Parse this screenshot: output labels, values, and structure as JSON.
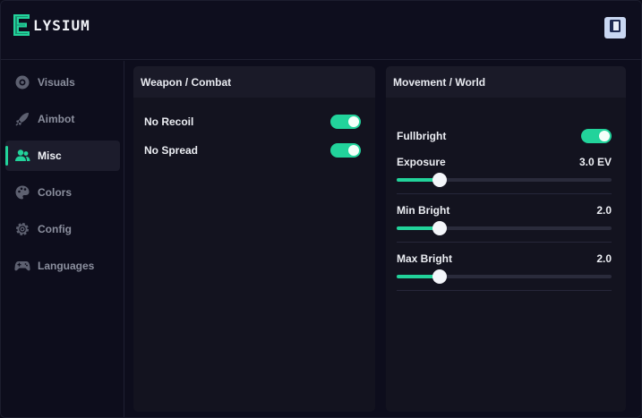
{
  "app": {
    "brand": "LYSIUM"
  },
  "header": {
    "button_icon": "book-icon"
  },
  "sidebar": {
    "items": [
      {
        "label": "Visuals",
        "icon": "eye-icon",
        "active": false
      },
      {
        "label": "Aimbot",
        "icon": "rocket-icon",
        "active": false
      },
      {
        "label": "Misc",
        "icon": "users-icon",
        "active": true
      },
      {
        "label": "Colors",
        "icon": "palette-icon",
        "active": false
      },
      {
        "label": "Config",
        "icon": "gear-icon",
        "active": false
      },
      {
        "label": "Languages",
        "icon": "gamepad-icon",
        "active": false
      }
    ]
  },
  "panels": {
    "weapon": {
      "title": "Weapon / Combat",
      "toggles": [
        {
          "label": "No Recoil",
          "on": true
        },
        {
          "label": "No Spread",
          "on": true
        }
      ]
    },
    "movement": {
      "title": "Movement / World",
      "fullbright": {
        "label": "Fullbright",
        "on": true
      },
      "sliders": [
        {
          "label": "Exposure",
          "value": "3.0 EV",
          "fraction": 0.2
        },
        {
          "label": "Min Bright",
          "value": "2.0",
          "fraction": 0.2
        },
        {
          "label": "Max Bright",
          "value": "2.0",
          "fraction": 0.2
        }
      ]
    }
  },
  "colors": {
    "accent": "#22d39b",
    "background": "#0d0d1c",
    "panel": "#13131f"
  }
}
